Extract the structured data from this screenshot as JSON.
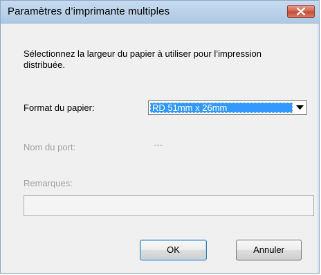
{
  "window": {
    "title": "Paramètres d’imprimante multiples"
  },
  "dialog": {
    "instructions": "Sélectionnez la largeur du papier à utiliser pour l’impression distribuée.",
    "paper_format_label": "Format du papier:",
    "paper_format_value": "RD 51mm x 26mm",
    "port_name_label": "Nom du port:",
    "port_name_value": "---",
    "remarks_label": "Remarques:",
    "remarks_value": ""
  },
  "buttons": {
    "ok": "OK",
    "cancel": "Annuler"
  },
  "icons": {
    "close": "close-icon",
    "dropdown": "chevron-down-icon"
  },
  "colors": {
    "title_bar": "#bcd3ea",
    "selection": "#3399ff",
    "close_button": "#c44a33",
    "disabled_text": "#a0a0a0"
  }
}
